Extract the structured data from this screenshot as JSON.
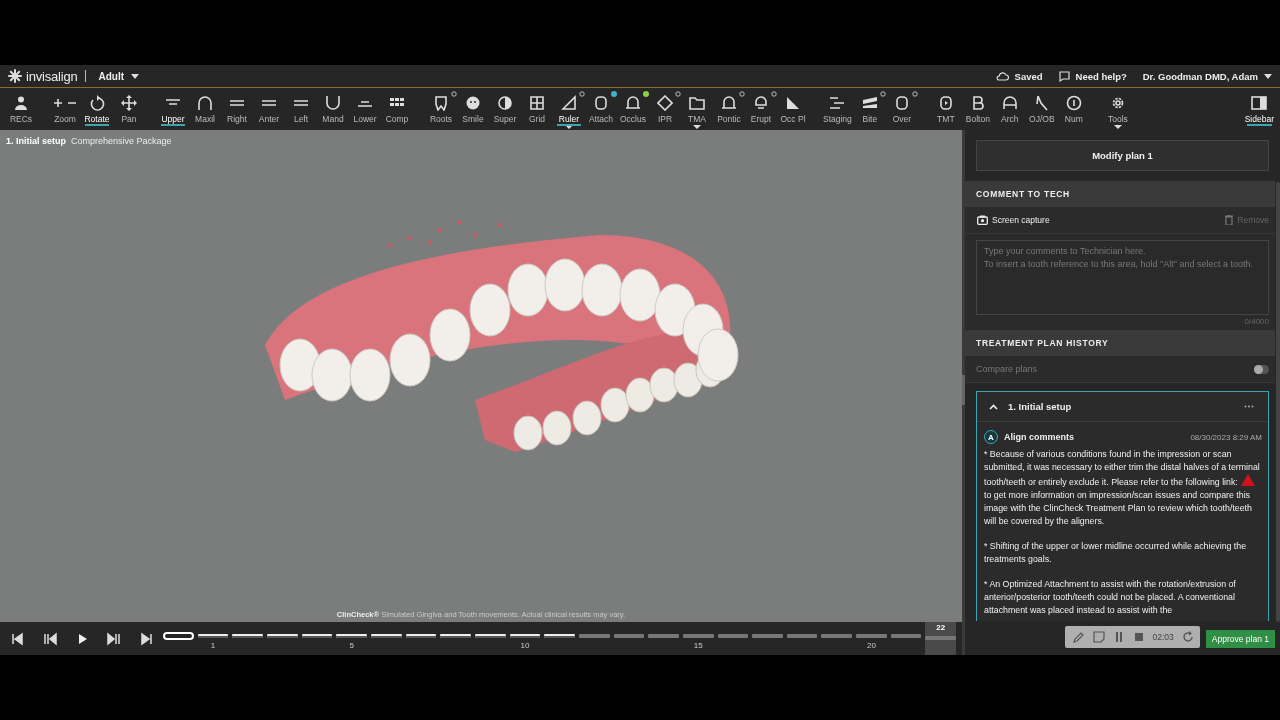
{
  "header": {
    "brand": "invisalign",
    "profile": "Adult",
    "status": "Saved",
    "help": "Need help?",
    "user": "Dr. Goodman DMD, Adam"
  },
  "toolbar": {
    "groups": [
      [
        {
          "label": "RECs",
          "selected": false
        }
      ],
      [
        {
          "label": "Zoom",
          "selected": false
        },
        {
          "label": "Rotate",
          "selected": true
        },
        {
          "label": "Pan",
          "selected": false
        }
      ],
      [
        {
          "label": "Upper",
          "selected": true
        },
        {
          "label": "Maxil",
          "selected": false
        },
        {
          "label": "Right",
          "selected": false
        },
        {
          "label": "Anter",
          "selected": false
        },
        {
          "label": "Left",
          "selected": false
        },
        {
          "label": "Mand",
          "selected": false
        },
        {
          "label": "Lower",
          "selected": false
        },
        {
          "label": "Comp",
          "selected": false
        }
      ],
      [
        {
          "label": "Roots",
          "selected": false,
          "kind": "ringed"
        },
        {
          "label": "Smile",
          "selected": false
        },
        {
          "label": "Super",
          "selected": false
        },
        {
          "label": "Grid",
          "selected": false
        },
        {
          "label": "Ruler",
          "selected": true,
          "kind": "ringed",
          "dropdown": true
        },
        {
          "label": "Attach",
          "selected": false,
          "kind": "dotted",
          "color": "#3fb4c8"
        },
        {
          "label": "Occlus",
          "selected": false,
          "kind": "dotted",
          "color": "#8cd04a"
        },
        {
          "label": "IPR",
          "selected": false,
          "kind": "ringed"
        },
        {
          "label": "TMA",
          "selected": false,
          "dropdown": true
        },
        {
          "label": "Pontic",
          "selected": false,
          "kind": "ringed"
        },
        {
          "label": "Erupt",
          "selected": false,
          "kind": "ringed"
        },
        {
          "label": "Occ Pl",
          "selected": false
        }
      ],
      [
        {
          "label": "Staging",
          "selected": false
        },
        {
          "label": "Bite",
          "selected": false,
          "kind": "ringed"
        },
        {
          "label": "Over",
          "selected": false,
          "kind": "ringed"
        }
      ],
      [
        {
          "label": "TMT",
          "selected": false
        },
        {
          "label": "Bolton",
          "selected": false
        },
        {
          "label": "Arch",
          "selected": false
        },
        {
          "label": "OJ/OB",
          "selected": false
        },
        {
          "label": "Num",
          "selected": false
        }
      ],
      [
        {
          "label": "Tools",
          "selected": false,
          "dropdown": true
        }
      ],
      [
        {
          "label": "Sidebar",
          "selected": true
        }
      ]
    ]
  },
  "viewport": {
    "title": "1. Initial setup",
    "subtitle": "Comprehensive Package",
    "disclaimer": "**ClinCheck®** Simulated Gingiva and Tooth movements. Actual clinical results may vary."
  },
  "timeline": {
    "stages": [
      {
        "reached": true,
        "selected": true
      },
      {
        "label": "1",
        "reached": true,
        "selected": false
      },
      {
        "reached": true,
        "selected": false
      },
      {
        "reached": true,
        "selected": false
      },
      {
        "reached": true,
        "selected": false
      },
      {
        "label": "5",
        "reached": true,
        "selected": false
      },
      {
        "reached": true,
        "selected": false
      },
      {
        "reached": true,
        "selected": false
      },
      {
        "reached": true,
        "selected": false
      },
      {
        "reached": true,
        "selected": false
      },
      {
        "label": "10",
        "reached": true,
        "selected": false
      },
      {
        "reached": true,
        "selected": false
      },
      {
        "reached": false,
        "selected": false
      },
      {
        "reached": false,
        "selected": false
      },
      {
        "reached": false,
        "selected": false
      },
      {
        "label": "15",
        "reached": false,
        "selected": false
      },
      {
        "reached": false,
        "selected": false
      },
      {
        "reached": false,
        "selected": false
      },
      {
        "reached": false,
        "selected": false
      },
      {
        "reached": false,
        "selected": false
      },
      {
        "label": "20",
        "reached": false,
        "selected": false
      },
      {
        "reached": false,
        "selected": false
      },
      {
        "label": "22",
        "reached": false,
        "selected": false,
        "kind": "final"
      }
    ]
  },
  "sidebar": {
    "modify_button": "Modify plan 1",
    "comment_section": {
      "title": "COMMENT TO TECH",
      "capture": "Screen capture",
      "remove": "Remove",
      "placeholder": "Type your comments to Technician here.\nTo insert a tooth reference to this area, hold \"Alt\" and select a tooth.",
      "counter": "0/4000"
    },
    "history_section": {
      "title": "TREATMENT PLAN HISTORY",
      "compare": {
        "label": "Compare plans",
        "on": false
      },
      "plans": [
        {
          "title": "1. Initial setup",
          "expanded": true,
          "comment": {
            "avatar": "A",
            "author": "Align comments",
            "date": "08/30/2023 8:29 AM",
            "paragraphs": [
              {
                "parts": [
                  "* Because of various conditions found in the impression or scan submitted, it was necessary to either trim the distal halves of a terminal tooth/teeth or entirely exclude it. Please refer to the following link:",
                  "to get more information on impression/scan issues and compare this image with the ClinCheck Treatment Plan to review which tooth/teeth will be covered by the aligners."
                ]
              },
              {
                "parts": [
                  "* Shifting of the upper or lower midline occurred while achieving the treatments goals."
                ]
              },
              {
                "parts": [
                  "* An Optimized Attachment to assist with the rotation/extrusion of anterior/posterior tooth/teeth could not be placed. A conventional attachment was placed instead to assist with the"
                ]
              }
            ]
          }
        }
      ]
    },
    "approve_button": "Approve plan 1"
  },
  "recorder": {
    "time": "02:03"
  }
}
